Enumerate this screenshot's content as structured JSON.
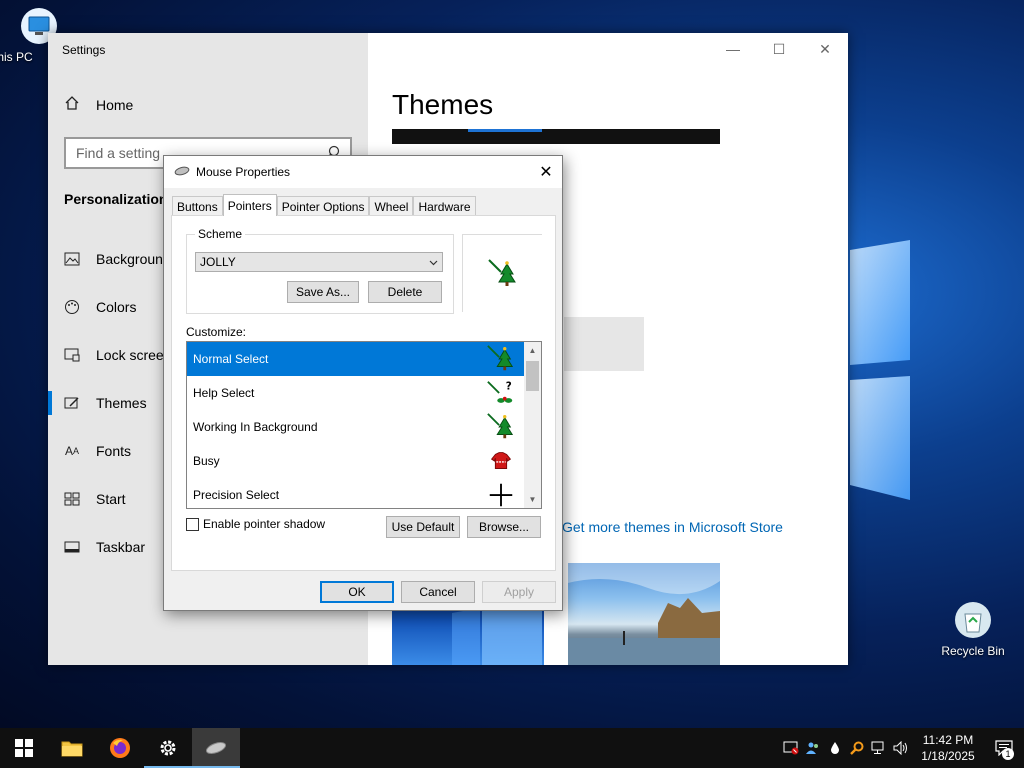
{
  "desktop": {
    "icons": [
      {
        "label": "This PC",
        "icon": "this-pc-icon"
      },
      {
        "label": "Recycle Bin",
        "icon": "recycle-bin-icon"
      }
    ]
  },
  "settings": {
    "title": "Settings",
    "home_label": "Home",
    "search_placeholder": "Find a setting",
    "section_title": "Personalization",
    "nav_items": [
      {
        "label": "Background",
        "icon": "background-icon"
      },
      {
        "label": "Colors",
        "icon": "palette-icon"
      },
      {
        "label": "Lock screen",
        "icon": "lock-screen-icon"
      },
      {
        "label": "Themes",
        "icon": "themes-icon",
        "active": true
      },
      {
        "label": "Fonts",
        "icon": "fonts-icon"
      },
      {
        "label": "Start",
        "icon": "start-icon"
      },
      {
        "label": "Taskbar",
        "icon": "taskbar-icon"
      }
    ],
    "content_title": "Themes",
    "store_link": "Get more themes in Microsoft Store",
    "accent_color": "#0078d7"
  },
  "dialog": {
    "title": "Mouse Properties",
    "tabs": [
      "Buttons",
      "Pointers",
      "Pointer Options",
      "Wheel",
      "Hardware"
    ],
    "active_tab": "Pointers",
    "scheme_label": "Scheme",
    "scheme_value": "JOLLY",
    "save_as_label": "Save As...",
    "delete_label": "Delete",
    "customize_label": "Customize:",
    "cursor_rows": [
      {
        "label": "Normal Select",
        "icon": "tree-arrow-icon",
        "selected": true
      },
      {
        "label": "Help Select",
        "icon": "holly-help-icon"
      },
      {
        "label": "Working In Background",
        "icon": "tree-arrow-icon"
      },
      {
        "label": "Busy",
        "icon": "sweater-icon"
      },
      {
        "label": "Precision Select",
        "icon": "crosshair-icon"
      }
    ],
    "shadow_label": "Enable pointer shadow",
    "use_default_label": "Use Default",
    "browse_label": "Browse...",
    "ok_label": "OK",
    "cancel_label": "Cancel",
    "apply_label": "Apply"
  },
  "taskbar": {
    "apps": [
      "start-icon",
      "file-explorer-icon",
      "firefox-icon",
      "settings-gear-icon",
      "mouse-icon"
    ],
    "time": "11:42 PM",
    "date": "1/18/2025",
    "notification_count": "1"
  }
}
